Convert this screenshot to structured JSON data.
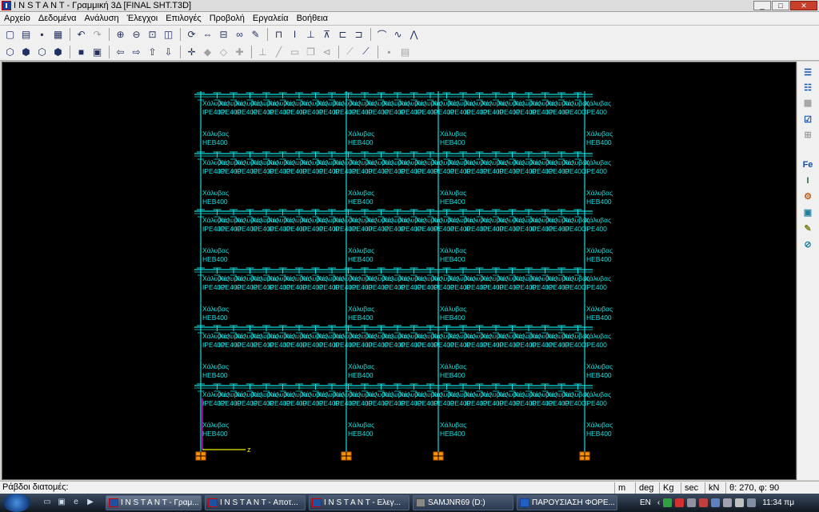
{
  "window": {
    "title": "I N S T A N T - Γραμμική 3Δ [FINAL SHT.T3D]",
    "minimize_label": "_",
    "maximize_label": "□",
    "close_label": "✕"
  },
  "menu": [
    "Αρχείο",
    "Δεδομένα",
    "Ανάλυση",
    "Έλεγχοι",
    "Επιλογές",
    "Προβολή",
    "Εργαλεία",
    "Βοήθεια"
  ],
  "drawing": {
    "column_material": "Χάλυβας",
    "column_section": "HEB400",
    "beam_material": "Χάλυβας",
    "beam_section": "IPE400",
    "axis_label": "z",
    "colors": {
      "frame": "#10e0e0",
      "support": "#ff9000",
      "axis_x": "#ff00ff",
      "axis_z": "#f0f000",
      "background": "#000000"
    }
  },
  "status": {
    "prompt": "Ράβδοι διατομές:",
    "units": [
      "m",
      "deg",
      "Kg",
      "sec",
      "kN"
    ],
    "view_angles": "θ: 270, φ: 90"
  },
  "taskbar": {
    "buttons": [
      {
        "label": "I N S T A N T - Γραμ...",
        "active": true
      },
      {
        "label": "I N S T A N T - Αποτ...",
        "active": false
      },
      {
        "label": "I N S T A N T - Ελεγ...",
        "active": false
      },
      {
        "label": "SAMJNR69 (D:)",
        "active": false
      },
      {
        "label": "ΠΑΡΟΥΣΙΑΣΗ ΦΟΡΕ...",
        "active": false
      }
    ],
    "language": "EN",
    "clock": "11:34 πμ"
  }
}
